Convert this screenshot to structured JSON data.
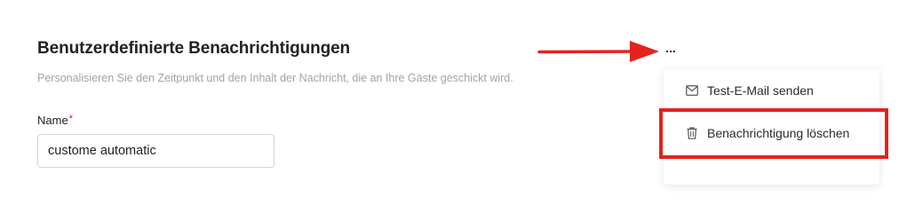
{
  "section": {
    "title": "Benutzerdefinierte Benachrichtigungen",
    "subtitle": "Personalisieren Sie den Zeitpunkt und den Inhalt der Nachricht, die an Ihre Gäste geschickt wird."
  },
  "form": {
    "name_label": "Name",
    "name_required_marker": "*",
    "name_value": "custome automatic"
  },
  "more_menu": {
    "button_label": "...",
    "items": [
      {
        "label": "Test-E-Mail senden",
        "icon": "mail-icon"
      },
      {
        "label": "Benachrichtigung löschen",
        "icon": "trash-icon"
      }
    ]
  },
  "annotation": {
    "color": "#e3231c"
  }
}
